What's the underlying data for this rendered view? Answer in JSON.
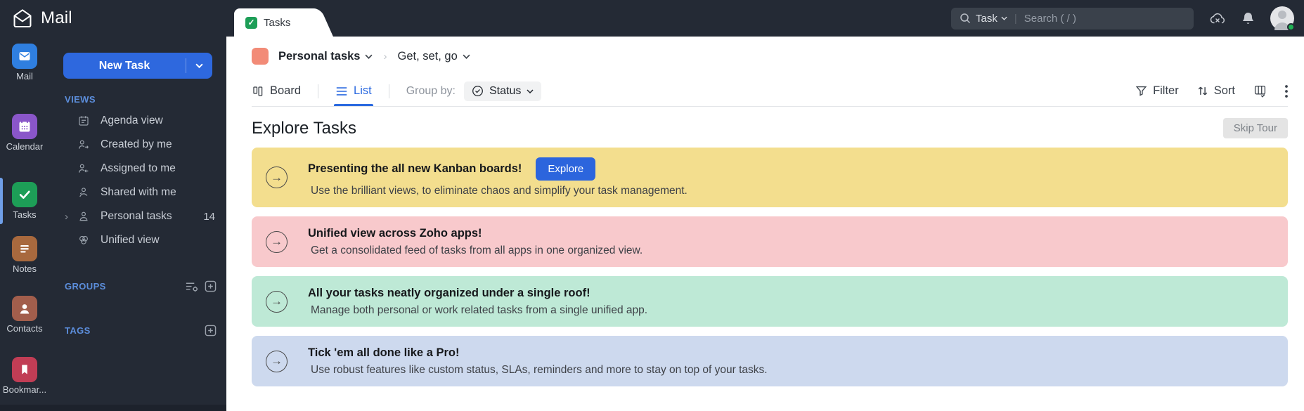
{
  "app": {
    "logo_text": "Mail"
  },
  "topbar": {
    "tab_label": "Tasks",
    "search": {
      "scope_label": "Task",
      "placeholder": "Search ( / )"
    }
  },
  "rail": {
    "items": [
      {
        "label": "Mail",
        "color": "#2f7fe0"
      },
      {
        "label": "Calendar",
        "color": "#8a56c9"
      },
      {
        "label": "Tasks",
        "color": "#1d9e57"
      },
      {
        "label": "Notes",
        "color": "#a8693e"
      },
      {
        "label": "Contacts",
        "color": "#a25e4c"
      },
      {
        "label": "Bookmar...",
        "color": "#c13d55"
      }
    ]
  },
  "sidebar": {
    "new_task_label": "New Task",
    "views_header": "VIEWS",
    "views": [
      {
        "label": "Agenda view"
      },
      {
        "label": "Created by me"
      },
      {
        "label": "Assigned to me"
      },
      {
        "label": "Shared with me"
      },
      {
        "label": "Personal tasks",
        "count": "14",
        "expander": "›"
      },
      {
        "label": "Unified view"
      }
    ],
    "groups_header": "GROUPS",
    "tags_header": "TAGS"
  },
  "breadcrumb": {
    "list_name": "Personal tasks",
    "separator": "›",
    "view_name": "Get, set, go",
    "swatch_color": "#f28b77"
  },
  "toolbar": {
    "board_label": "Board",
    "list_label": "List",
    "group_by_label": "Group by:",
    "group_by_value": "Status",
    "filter_label": "Filter",
    "sort_label": "Sort"
  },
  "explore": {
    "title": "Explore Tasks",
    "skip_label": "Skip Tour"
  },
  "banners": [
    {
      "title": "Presenting the all new Kanban boards!",
      "subtitle": "Use the brilliant views, to eliminate chaos and simplify your task management.",
      "color": "#f3de8e",
      "action_label": "Explore",
      "arrow": "→"
    },
    {
      "title": "Unified view across Zoho apps!",
      "subtitle": "Get a consolidated feed of tasks from all apps in one organized view.",
      "color": "#f8c9cc",
      "arrow": "→"
    },
    {
      "title": "All your tasks neatly organized under a single roof!",
      "subtitle": "Manage both personal or work related tasks from a single unified app.",
      "color": "#bee9d6",
      "arrow": "→"
    },
    {
      "title": "Tick 'em all done like a Pro!",
      "subtitle": "Use robust features like custom status, SLAs, reminders and more to stay on top of your tasks.",
      "color": "#cdd9ee",
      "arrow": "→"
    }
  ],
  "colors": {
    "accent_blue": "#2c6ae0",
    "topbar_bg": "#242a35",
    "active_green": "#1d9e57"
  }
}
